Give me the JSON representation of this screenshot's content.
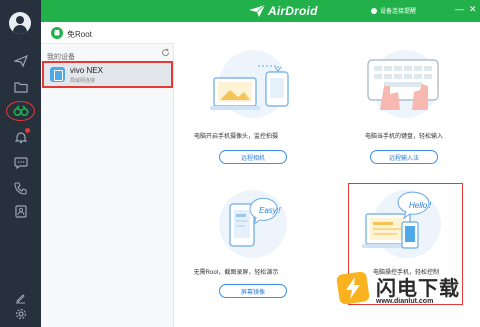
{
  "header": {
    "logo_text": "AirDroid",
    "connection_status": "设备连接提醒",
    "minimize": "—",
    "close": "✕",
    "accent_color": "#22b04b"
  },
  "rail": {
    "icons": [
      "user-avatar-icon",
      "send-icon",
      "folder-icon",
      "binoculars-icon",
      "bell-icon",
      "chat-icon",
      "phone-call-icon",
      "contacts-icon",
      "edit-icon",
      "settings-icon"
    ]
  },
  "panel": {
    "root_label": "免Root",
    "my_devices_label": "我的设备",
    "devices": [
      {
        "name": "vivo NEX",
        "status": "局域网连接"
      }
    ]
  },
  "cards": [
    {
      "title": "电脑开启手机摄像头，监控拍摄",
      "button": "远程相机"
    },
    {
      "title": "电脑当手机的键盘，轻松输入",
      "button": "远程输入法"
    },
    {
      "title": "无需Root，截图录屏，轻松演示",
      "button": "屏幕镜像"
    },
    {
      "title": "电脑操控手机，轻松控制",
      "button": ""
    }
  ],
  "bubbles": {
    "easy": "Easy！",
    "hello": "Hello！"
  },
  "watermark": {
    "text": "闪电下载",
    "url": "www.dianlut.com"
  },
  "colors": {
    "highlight": "#e53935",
    "button_border": "#3a8ee6",
    "rail_bg": "#26313d"
  }
}
